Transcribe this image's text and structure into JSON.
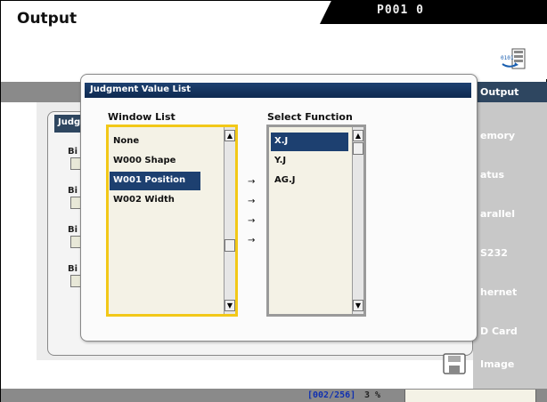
{
  "header": {
    "title": "Output",
    "tab_text": "P001 0"
  },
  "right_menu": {
    "items": [
      {
        "label": "Output"
      },
      {
        "label": "emory"
      },
      {
        "label": "atus"
      },
      {
        "label": "arallel"
      },
      {
        "label": "S232"
      },
      {
        "label": "hernet"
      },
      {
        "label": "D Card"
      },
      {
        "label": "Image"
      }
    ]
  },
  "background": {
    "panel_title": "Judg",
    "bit_labels": [
      "Bi",
      "Bi",
      "Bi",
      "Bi"
    ]
  },
  "dialog": {
    "title": "Judgment Value List",
    "window_list_label": "Window List",
    "select_function_label": "Select Function",
    "window_list_items": [
      "None",
      "W000 Shape",
      "W001 Position",
      "W002 Width"
    ],
    "window_list_selected": "W001 Position",
    "select_function_items": [
      "X.J",
      "Y.J",
      "AG.J"
    ],
    "select_function_selected": "X.J",
    "arrows": [
      "→",
      "→",
      "→",
      "→"
    ]
  },
  "status_bar": {
    "count": "[002/256]",
    "percent": "3 %"
  },
  "colors": {
    "selected_bg": "#1d4070",
    "focus_border": "#f2c818",
    "list_bg": "#f4f2e6",
    "menu_active": "#2e4660"
  },
  "icons": [
    "transfer-icon",
    "floppy-disk-icon",
    "scroll-up-icon",
    "scroll-down-icon",
    "arrow-right-icon"
  ]
}
